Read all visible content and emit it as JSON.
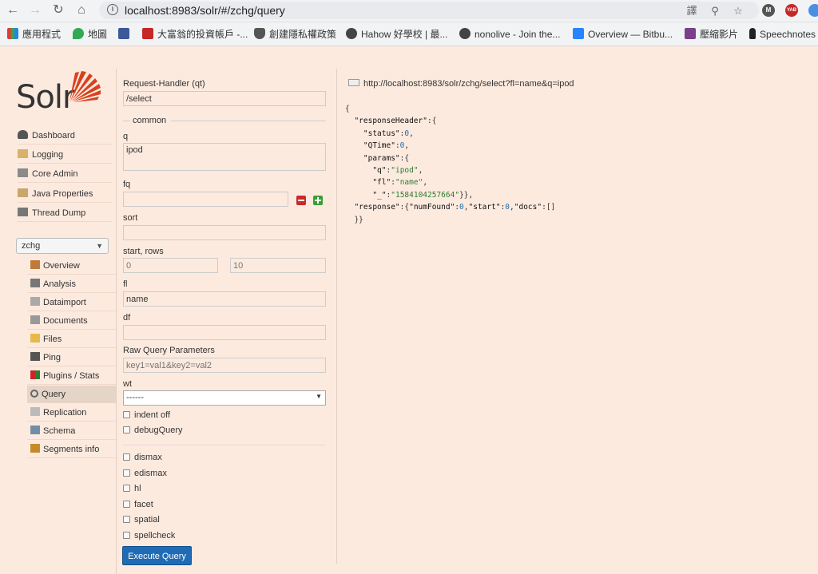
{
  "browser": {
    "url": "localhost:8983/solr/#/zchg/query",
    "avatars": [
      "M",
      "YAB"
    ],
    "bookmarks": [
      "應用程式",
      "地圖",
      "",
      "大富翁的投資帳戶 -...",
      "創建隱私權政策",
      "Hahow 好學校 | 最...",
      "nonolive - Join the...",
      "Overview — Bitbu...",
      "壓縮影片",
      "Speechnotes"
    ]
  },
  "logo": "Solr",
  "menu": [
    "Dashboard",
    "Logging",
    "Core Admin",
    "Java Properties",
    "Thread Dump"
  ],
  "core": {
    "selected": "zchg",
    "items": [
      "Overview",
      "Analysis",
      "Dataimport",
      "Documents",
      "Files",
      "Ping",
      "Plugins / Stats",
      "Query",
      "Replication",
      "Schema",
      "Segments info"
    ],
    "active": "Query"
  },
  "form": {
    "request_handler_label": "Request-Handler (qt)",
    "request_handler_value": "/select",
    "common_legend": "common",
    "q_label": "q",
    "q_value": "ipod",
    "fq_label": "fq",
    "fq_value": "",
    "sort_label": "sort",
    "sort_value": "",
    "start_rows_label": "start, rows",
    "start_placeholder": "0",
    "rows_placeholder": "10",
    "fl_label": "fl",
    "fl_value": "name",
    "df_label": "df",
    "df_value": "",
    "raw_label": "Raw Query Parameters",
    "raw_placeholder": "key1=val1&key2=val2",
    "wt_label": "wt",
    "wt_value": "------",
    "checkboxes": [
      "indent off",
      "debugQuery",
      "dismax",
      "edismax",
      "hl",
      "facet",
      "spatial",
      "spellcheck"
    ],
    "execute_label": "Execute Query"
  },
  "response": {
    "url": "http://localhost:8983/solr/zchg/select?fl=name&q=ipod",
    "status": "0",
    "qtime": "0",
    "q": "ipod",
    "fl": "name",
    "underscore": "1584104257664",
    "numFound": "0",
    "start": "0"
  }
}
